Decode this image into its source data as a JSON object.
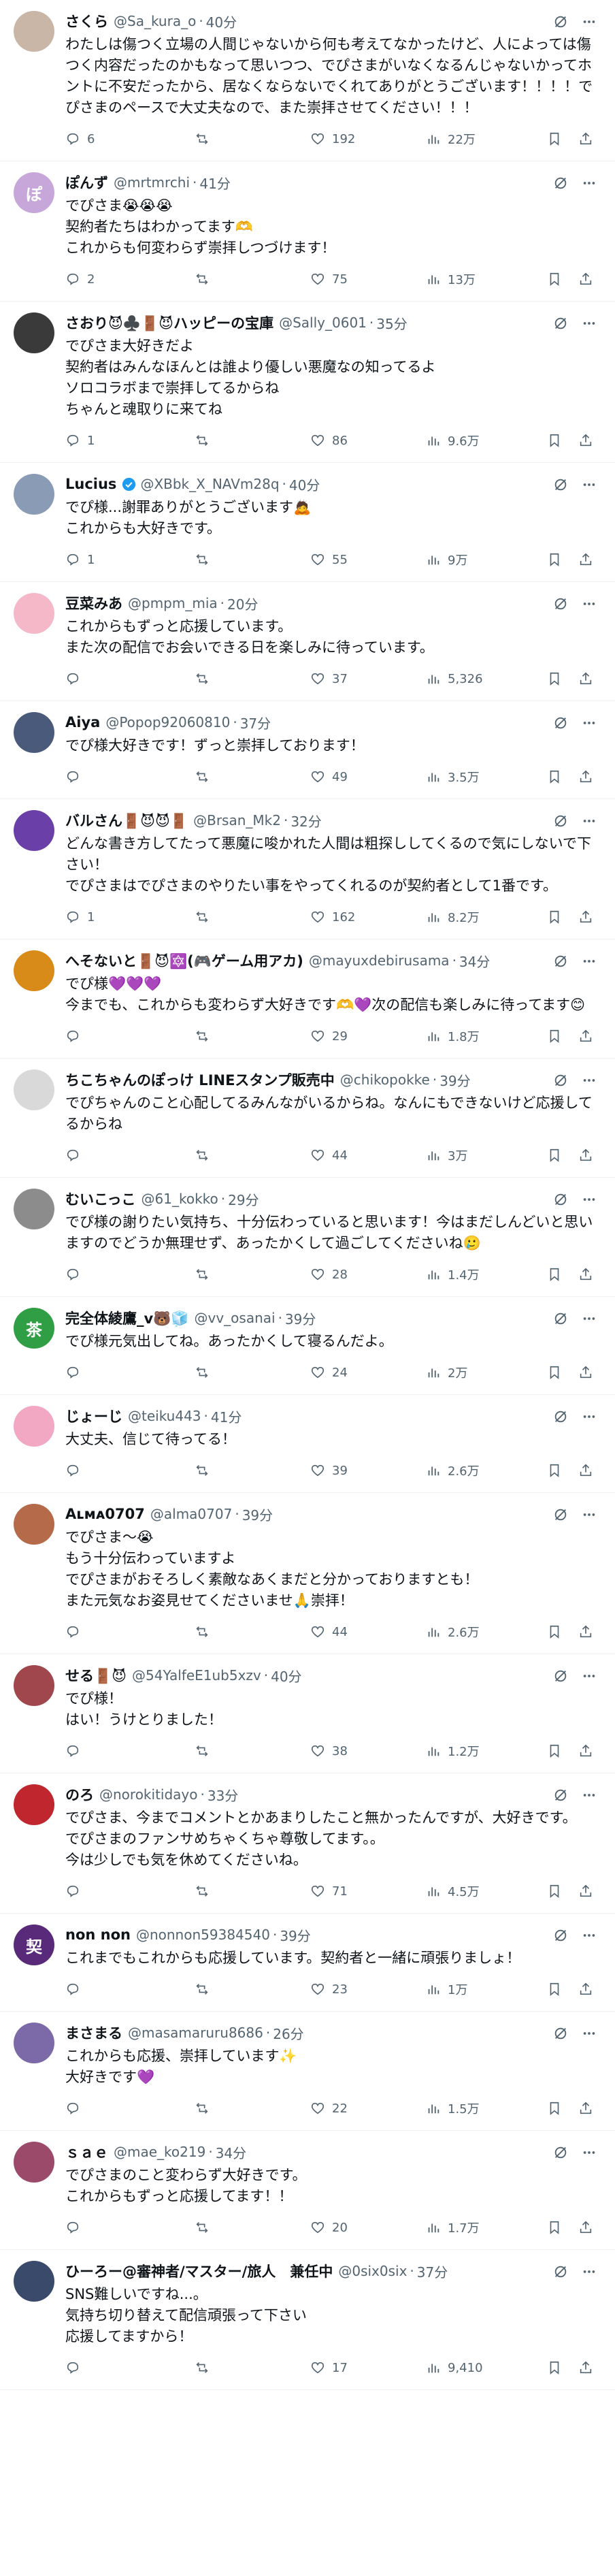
{
  "posts": [
    {
      "name": "さくら",
      "handle": "@Sa_kura_o",
      "time": "40分",
      "verified": false,
      "avatar_text": "",
      "avatar_color": "#c9b6a6",
      "text": "わたしは傷つく立場の人間じゃないから何も考えてなかったけど、人によっては傷つく内容だったのかもなって思いつつ、でぴさまがいなくなるんじゃないかってホントに不安だったから、居なくならないでくれてありがとうございます！！！！でぴさまのペースで大丈夫なので、また崇拝させてください！！！",
      "replies": "6",
      "reposts": "",
      "likes": "192",
      "views": "22万"
    },
    {
      "name": "ぽんず",
      "handle": "@mrtmrchi",
      "time": "41分",
      "verified": false,
      "avatar_text": "ぽ",
      "avatar_color": "#c7a6d9",
      "text": "でぴさま😭😭😭\n契約者たちはわかってます🫶\nこれからも何変わらず崇拝しつづけます！",
      "replies": "2",
      "reposts": "",
      "likes": "75",
      "views": "13万"
    },
    {
      "name": "さおり😈♣️🚪😈ハッピーの宝庫",
      "handle": "@Sally_0601",
      "time": "35分",
      "verified": false,
      "avatar_text": "",
      "avatar_color": "#3a3a3a",
      "text": "でぴさま大好きだよ\n契約者はみんなほんとは誰より優しい悪魔なの知ってるよ\nソロコラボまで崇拝してるからね\nちゃんと魂取りに来てね",
      "replies": "1",
      "reposts": "",
      "likes": "86",
      "views": "9.6万"
    },
    {
      "name": "Lucius",
      "handle": "@XBbk_X_NAVm28q",
      "time": "40分",
      "verified": true,
      "avatar_text": "",
      "avatar_color": "#8a9cb5",
      "text": "でぴ様...謝罪ありがとうございます🙇\nこれからも大好きです。",
      "replies": "1",
      "reposts": "",
      "likes": "55",
      "views": "9万"
    },
    {
      "name": "豆菜みあ",
      "handle": "@pmpm_mia",
      "time": "20分",
      "verified": false,
      "avatar_text": "",
      "avatar_color": "#f4b8c8",
      "text": "これからもずっと応援しています。\nまた次の配信でお会いできる日を楽しみに待っています。",
      "replies": "",
      "reposts": "",
      "likes": "37",
      "views": "5,326"
    },
    {
      "name": "Aiya",
      "handle": "@Popop92060810",
      "time": "37分",
      "verified": false,
      "avatar_text": "",
      "avatar_color": "#4a5a7a",
      "text": "でぴ様大好きです！ずっと崇拝しております！",
      "replies": "",
      "reposts": "",
      "likes": "49",
      "views": "3.5万"
    },
    {
      "name": "バルさん🚪😈😈🚪",
      "handle": "@Brsan_Mk2",
      "time": "32分",
      "verified": false,
      "avatar_text": "",
      "avatar_color": "#6a3fa8",
      "text": "どんな書き方してたって悪魔に唆かれた人間は粗探ししてくるので気にしないで下さい！\nでぴさまはでぴさまのやりたい事をやってくれるのが契約者として1番です。",
      "replies": "1",
      "reposts": "",
      "likes": "162",
      "views": "8.2万"
    },
    {
      "name": "へそないと🚪😈🔯(🎮ゲーム用アカ)",
      "handle": "@mayuxdebirusama",
      "time": "34分",
      "verified": false,
      "avatar_text": "",
      "avatar_color": "#d98b1a",
      "text": "でぴ様💜💜💜\n今までも、これからも変わらず大好きです🫶💜次の配信も楽しみに待ってます😊",
      "replies": "",
      "reposts": "",
      "likes": "29",
      "views": "1.8万"
    },
    {
      "name": "ちこちゃんのぽっけ LINEスタンプ販売中",
      "handle": "@chikopokke",
      "time": "39分",
      "verified": false,
      "avatar_text": "",
      "avatar_color": "#d9d9d9",
      "text": "でぴちゃんのこと心配してるみんながいるからね。なんにもできないけど応援してるからね",
      "replies": "",
      "reposts": "",
      "likes": "44",
      "views": "3万"
    },
    {
      "name": "むいこっこ",
      "handle": "@61_kokko",
      "time": "29分",
      "verified": false,
      "avatar_text": "",
      "avatar_color": "#8c8c8c",
      "text": "でぴ様の謝りたい気持ち、十分伝わっていると思います！今はまだしんどいと思いますのでどうか無理せず、あったかくして過ごしてくださいね🥲",
      "replies": "",
      "reposts": "",
      "likes": "28",
      "views": "1.4万"
    },
    {
      "name": "完全体綾鷹_v🐻🧊",
      "handle": "@vv_osanai",
      "time": "39分",
      "verified": false,
      "avatar_text": "茶",
      "avatar_color": "#2f9e44",
      "text": "でぴ様元気出してね。あったかくして寝るんだよ。",
      "replies": "",
      "reposts": "",
      "likes": "24",
      "views": "2万"
    },
    {
      "name": "じょーじ",
      "handle": "@teiku443",
      "time": "41分",
      "verified": false,
      "avatar_text": "",
      "avatar_color": "#f2a7c3",
      "text": "大丈夫、信じて待ってる！",
      "replies": "",
      "reposts": "",
      "likes": "39",
      "views": "2.6万"
    },
    {
      "name": "Aʟᴍᴀ0707",
      "handle": "@alma0707",
      "time": "39分",
      "verified": false,
      "avatar_text": "",
      "avatar_color": "#b56b4a",
      "text": "でぴさま〜😭\nもう十分伝わっていますよ\nでぴさまがおそろしく素敵なあくまだと分かっておりますとも！\nまた元気なお姿見せてくださいませ🙏崇拝！",
      "replies": "",
      "reposts": "",
      "likes": "44",
      "views": "2.6万"
    },
    {
      "name": "せる🚪😈",
      "handle": "@54YalfeE1ub5xzv",
      "time": "40分",
      "verified": false,
      "avatar_text": "",
      "avatar_color": "#a0464d",
      "text": "でぴ様！\nはい！うけとりました！",
      "replies": "",
      "reposts": "",
      "likes": "38",
      "views": "1.2万"
    },
    {
      "name": "のろ",
      "handle": "@norokitidayo",
      "time": "33分",
      "verified": false,
      "avatar_text": "",
      "avatar_color": "#c0262d",
      "text": "でぴさま、今までコメントとかあまりしたこと無かったんですが、大好きです。\nでぴさまのファンサめちゃくちゃ尊敬してます。。\n今は少しでも気を休めてくださいね。",
      "replies": "",
      "reposts": "",
      "likes": "71",
      "views": "4.5万"
    },
    {
      "name": "non non",
      "handle": "@nonnon59384540",
      "time": "39分",
      "verified": false,
      "avatar_text": "契",
      "avatar_color": "#5a2a7a",
      "text": "これまでもこれからも応援しています。契約者と一緒に頑張りましょ！",
      "replies": "",
      "reposts": "",
      "likes": "23",
      "views": "1万"
    },
    {
      "name": "まさまる",
      "handle": "@masamaruru8686",
      "time": "26分",
      "verified": false,
      "avatar_text": "",
      "avatar_color": "#7c6aa8",
      "text": "これからも応援、崇拝しています✨\n大好きです💜",
      "replies": "",
      "reposts": "",
      "likes": "22",
      "views": "1.5万"
    },
    {
      "name": "ｓａｅ",
      "handle": "@mae_ko219",
      "time": "34分",
      "verified": false,
      "avatar_text": "",
      "avatar_color": "#9b4a6a",
      "text": "でぴさまのこと変わらず大好きです。\nこれからもずっと応援してます！！",
      "replies": "",
      "reposts": "",
      "likes": "20",
      "views": "1.7万"
    },
    {
      "name": "ひーろー@審神者/マスター/旅人　兼任中",
      "handle": "@0six0six",
      "time": "37分",
      "verified": false,
      "avatar_text": "",
      "avatar_color": "#3a4a6a",
      "text": "SNS難しいですね...。\n気持ち切り替えて配信頑張って下さい\n応援してますから！",
      "replies": "",
      "reposts": "",
      "likes": "17",
      "views": "9,410"
    }
  ],
  "colors": {
    "accent": "#1d9bf0",
    "muted": "#536471",
    "text": "#0f1419",
    "divider": "#eff3f4"
  }
}
